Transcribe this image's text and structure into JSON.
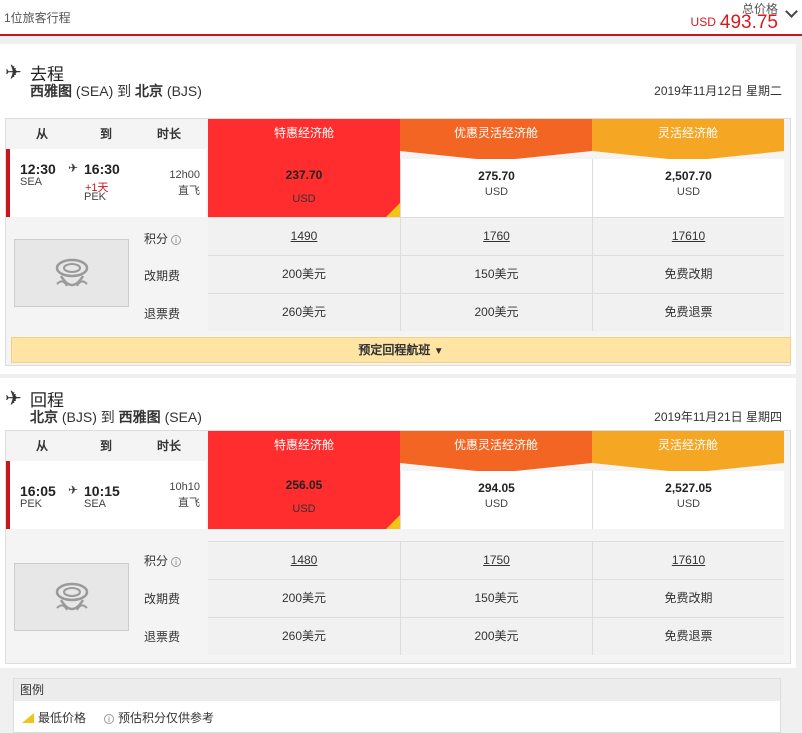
{
  "header": {
    "passengers": "1位旅客行程",
    "total_label": "总价格",
    "total_currency": "USD",
    "total_amount": "493.75"
  },
  "fare_columns": [
    {
      "label": "特惠经济舱",
      "color": "#ff2d2d"
    },
    {
      "label": "优惠灵活经济舱",
      "color": "#f26522"
    },
    {
      "label": "灵活经济舱",
      "color": "#f5a623"
    }
  ],
  "table_headers": {
    "from": "从",
    "to": "到",
    "duration": "时长"
  },
  "info_labels": {
    "points": "积分",
    "change_fee": "改期费",
    "refund_fee": "退票费"
  },
  "outbound": {
    "title": "去程",
    "from_city": "西雅图",
    "from_code": "(SEA)",
    "connector": "到",
    "to_city": "北京",
    "to_code": "(BJS)",
    "date": "2019年11月12日 星期二",
    "dep_time": "12:30",
    "dep_code": "SEA",
    "arr_time": "16:30",
    "arr_code": "PEK",
    "plus_day": "+1天",
    "duration": "12h00",
    "stops": "直飞",
    "fares": [
      {
        "price": "237.70",
        "currency": "USD",
        "points": "1490",
        "change": "200美元",
        "refund": "260美元"
      },
      {
        "price": "275.70",
        "currency": "USD",
        "points": "1760",
        "change": "150美元",
        "refund": "200美元"
      },
      {
        "price": "2,507.70",
        "currency": "USD",
        "points": "17610",
        "change": "免费改期",
        "refund": "免费退票"
      }
    ]
  },
  "book_return": "预定回程航班",
  "inbound": {
    "title": "回程",
    "from_city": "北京",
    "from_code": "(BJS)",
    "connector": "到",
    "to_city": "西雅图",
    "to_code": "(SEA)",
    "date": "2019年11月21日 星期四",
    "dep_time": "16:05",
    "dep_code": "PEK",
    "arr_time": "10:15",
    "arr_code": "SEA",
    "duration": "10h10",
    "stops": "直飞",
    "fares": [
      {
        "price": "256.05",
        "currency": "USD",
        "points": "1480",
        "change": "200美元",
        "refund": "260美元"
      },
      {
        "price": "294.05",
        "currency": "USD",
        "points": "1750",
        "change": "150美元",
        "refund": "200美元"
      },
      {
        "price": "2,527.05",
        "currency": "USD",
        "points": "17610",
        "change": "免费改期",
        "refund": "免费退票"
      }
    ]
  },
  "legend": {
    "title": "图例",
    "lowest": "最低价格",
    "points_note": "预估积分仅供参考"
  }
}
